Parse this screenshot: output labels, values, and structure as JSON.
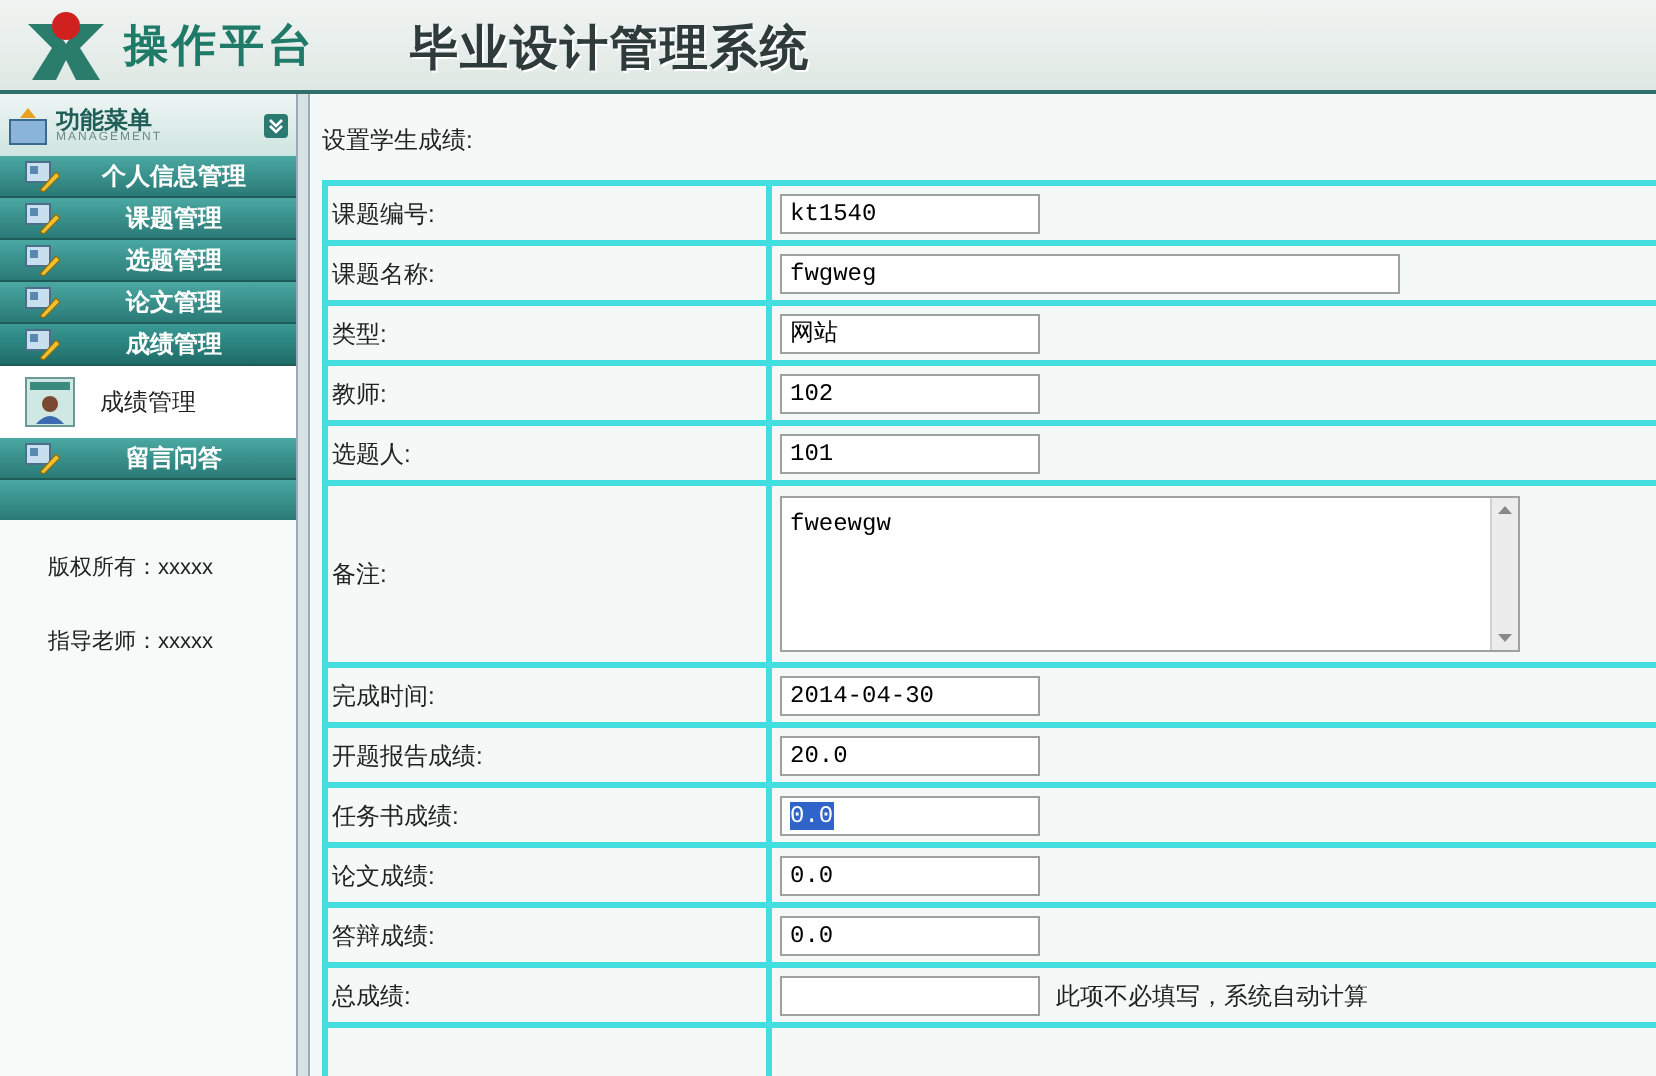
{
  "header": {
    "logo_text": "操作平台",
    "title": "毕业设计管理系统"
  },
  "sidebar": {
    "menu_title": "功能菜单",
    "menu_subtitle": "MANAGEMENT",
    "items": [
      {
        "label": "个人信息管理",
        "expanded": false
      },
      {
        "label": "课题管理",
        "expanded": false
      },
      {
        "label": "选题管理",
        "expanded": false
      },
      {
        "label": "论文管理",
        "expanded": false
      },
      {
        "label": "成绩管理",
        "expanded": true,
        "children": [
          {
            "label": "成绩管理"
          }
        ]
      },
      {
        "label": "留言问答",
        "expanded": false
      }
    ],
    "footer": [
      "版权所有：xxxxx",
      "指导老师：xxxxx"
    ]
  },
  "form": {
    "title": "设置学生成绩:",
    "rows": [
      {
        "label": "课题编号:",
        "kind": "text",
        "value": "kt1540",
        "wide": false,
        "selected": false
      },
      {
        "label": "课题名称:",
        "kind": "text",
        "value": "fwgweg",
        "wide": true,
        "selected": false
      },
      {
        "label": "类型:",
        "kind": "text",
        "value": "网站",
        "wide": false,
        "selected": false
      },
      {
        "label": "教师:",
        "kind": "text",
        "value": "102",
        "wide": false,
        "selected": false
      },
      {
        "label": "选题人:",
        "kind": "text",
        "value": "101",
        "wide": false,
        "selected": false
      },
      {
        "label": "备注:",
        "kind": "textarea",
        "value": "fweewgw"
      },
      {
        "label": "完成时间:",
        "kind": "text",
        "value": "2014-04-30",
        "wide": false,
        "selected": false
      },
      {
        "label": "开题报告成绩:",
        "kind": "text",
        "value": "20.0",
        "wide": false,
        "selected": false
      },
      {
        "label": "任务书成绩:",
        "kind": "text",
        "value": "0.0",
        "wide": false,
        "selected": true
      },
      {
        "label": "论文成绩:",
        "kind": "text",
        "value": "0.0",
        "wide": false,
        "selected": false
      },
      {
        "label": "答辩成绩:",
        "kind": "text",
        "value": "0.0",
        "wide": false,
        "selected": false
      },
      {
        "label": "总成绩:",
        "kind": "total",
        "wide": false,
        "note": "此项不必填写，系统自动计算"
      }
    ]
  }
}
